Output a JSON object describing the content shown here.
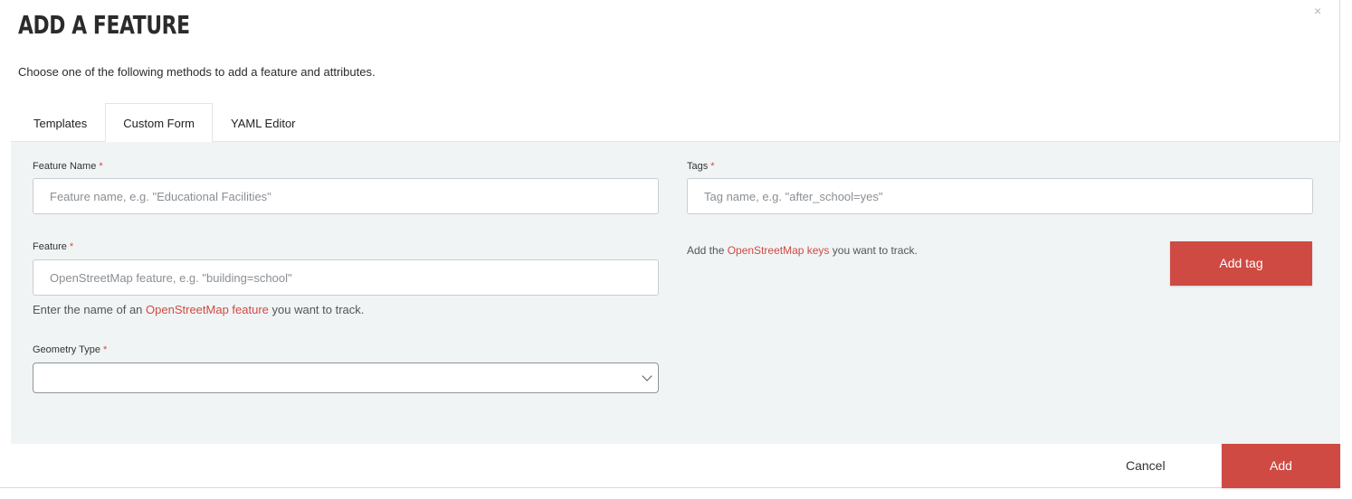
{
  "modal": {
    "title": "ADD A FEATURE",
    "close_glyph": "×",
    "subtitle": "Choose one of the following methods to add a feature and attributes."
  },
  "tabs": [
    {
      "label": "Templates",
      "active": false
    },
    {
      "label": "Custom Form",
      "active": true
    },
    {
      "label": "YAML Editor",
      "active": false
    }
  ],
  "form": {
    "feature_name": {
      "label": "Feature Name",
      "required_mark": "*",
      "value": "",
      "placeholder": "Feature name, e.g. \"Educational Facilities\""
    },
    "feature": {
      "label": "Feature",
      "required_mark": "*",
      "value": "",
      "placeholder": "OpenStreetMap feature, e.g. \"building=school\"",
      "help_prefix": "Enter the name of an ",
      "help_link": "OpenStreetMap feature",
      "help_suffix": " you want to track."
    },
    "geometry_type": {
      "label": "Geometry Type",
      "required_mark": "*",
      "selected": ""
    },
    "tags": {
      "label": "Tags",
      "required_mark": "*",
      "value": "",
      "placeholder": "Tag name, e.g. \"after_school=yes\"",
      "help_prefix": "Add the ",
      "help_link": "OpenStreetMap keys",
      "help_suffix": " you want to track.",
      "add_button": "Add tag"
    }
  },
  "footer": {
    "cancel_label": "Cancel",
    "add_label": "Add"
  },
  "colors": {
    "accent": "#cf4a43",
    "panel_bg": "#f1f4f5"
  },
  "icons": {
    "close": "close-icon",
    "select_chevron": "chevron-down-icon"
  }
}
